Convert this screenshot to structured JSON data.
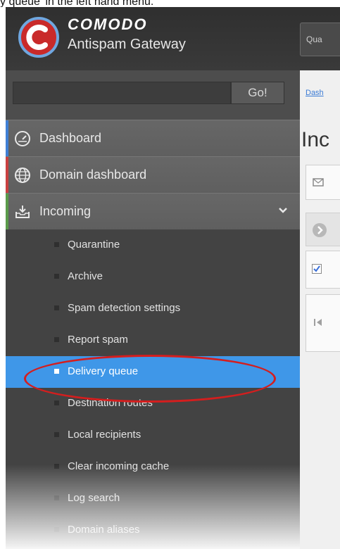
{
  "caption": "y queue' in the left hand menu.",
  "brand": {
    "name": "COMODO",
    "product": "Antispam Gateway"
  },
  "header": {
    "button_label": "Qua"
  },
  "search": {
    "value": "",
    "go_label": "Go!"
  },
  "menu": [
    {
      "label": "Dashboard",
      "icon": "gauge-icon",
      "accent": "#3f7fd4"
    },
    {
      "label": "Domain dashboard",
      "icon": "globe-icon",
      "accent": "#c94040"
    },
    {
      "label": "Incoming",
      "icon": "inbox-icon",
      "accent": "#5a9a4a",
      "expanded": true
    }
  ],
  "submenu": [
    {
      "label": "Quarantine"
    },
    {
      "label": "Archive"
    },
    {
      "label": "Spam detection settings"
    },
    {
      "label": "Report spam"
    },
    {
      "label": "Delivery queue",
      "active": true
    },
    {
      "label": "Destination routes"
    },
    {
      "label": "Local recipients"
    },
    {
      "label": "Clear incoming cache"
    },
    {
      "label": "Log search"
    },
    {
      "label": "Domain aliases"
    }
  ],
  "main": {
    "breadcrumb": "Dash",
    "title": "Inc"
  },
  "colors": {
    "active": "#3f97e8",
    "highlight_oval": "#d41e1e",
    "header": "#333333"
  }
}
